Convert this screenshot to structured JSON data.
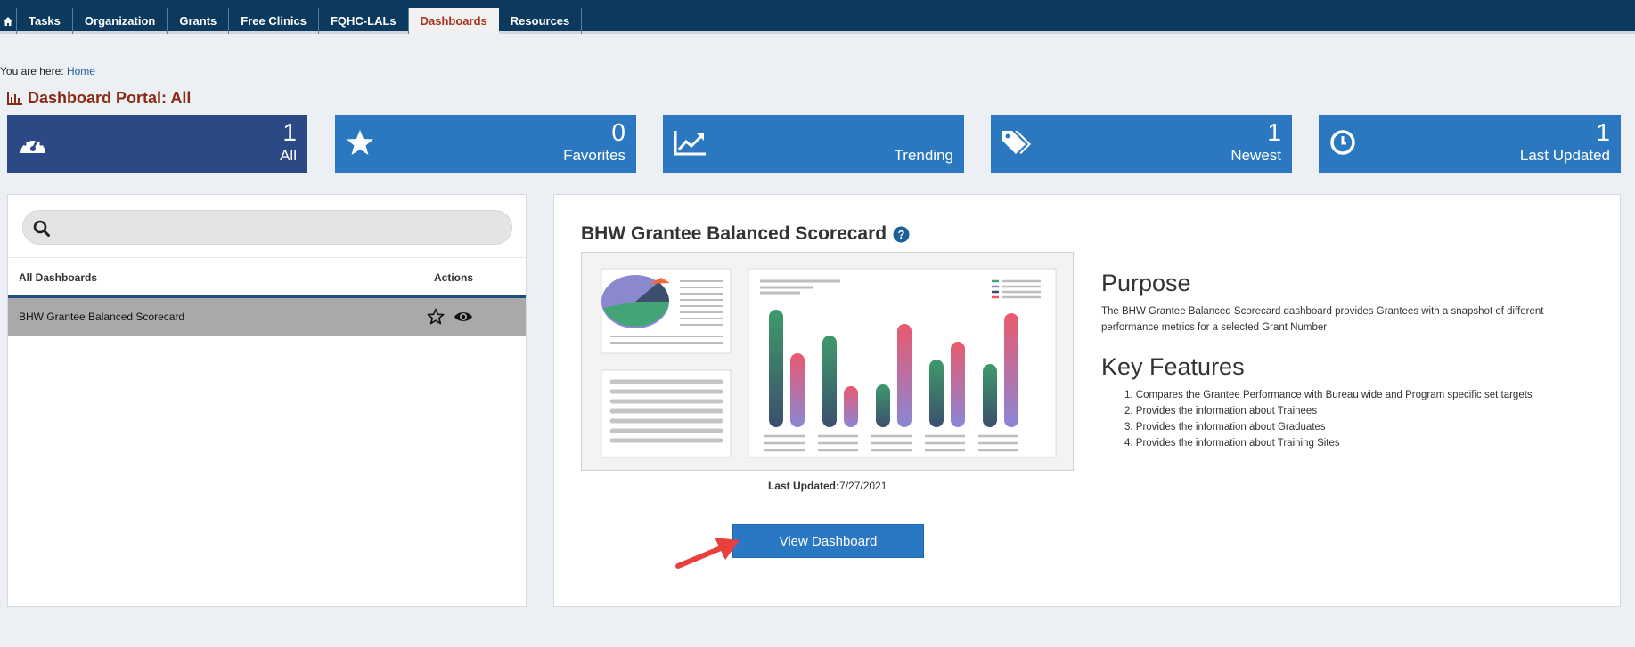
{
  "nav": {
    "items": [
      {
        "label": "Tasks"
      },
      {
        "label": "Organization"
      },
      {
        "label": "Grants"
      },
      {
        "label": "Free Clinics"
      },
      {
        "label": "FQHC-LALs"
      },
      {
        "label": "Dashboards",
        "active": true
      },
      {
        "label": "Resources"
      }
    ]
  },
  "breadcrumb": {
    "prefix": "You are here:",
    "home": "Home"
  },
  "page": {
    "title": "Dashboard Portal: All"
  },
  "tiles": [
    {
      "number": "1",
      "label": "All",
      "color": "#2b4a85",
      "icon": "gauge-icon"
    },
    {
      "number": "0",
      "label": "Favorites",
      "color": "#2b78c0",
      "icon": "star-icon"
    },
    {
      "number": "",
      "label": "Trending",
      "color": "#2b78c0",
      "icon": "trend-icon"
    },
    {
      "number": "1",
      "label": "Newest",
      "color": "#2b78c0",
      "icon": "tags-icon"
    },
    {
      "number": "1",
      "label": "Last Updated",
      "color": "#2b78c0",
      "icon": "clock-icon"
    }
  ],
  "search": {
    "value": "",
    "placeholder": ""
  },
  "table": {
    "col_all": "All Dashboards",
    "col_actions": "Actions",
    "rows": [
      {
        "name": "BHW Grantee Balanced Scorecard"
      }
    ]
  },
  "detail": {
    "title": "BHW Grantee Balanced Scorecard",
    "last_updated_label": "Last Updated:",
    "last_updated_value": "7/27/2021",
    "purpose_heading": "Purpose",
    "purpose_text": "The BHW Grantee Balanced Scorecard dashboard provides Grantees with a snapshot of different performance metrics for a selected Grant Number",
    "features_heading": "Key Features",
    "features": [
      "1. Compares the Grantee Performance with Bureau wide and Program specific set targets",
      "2. Provides the information about Trainees",
      "3. Provides the information about Graduates",
      "4. Provides the information about Training Sites"
    ],
    "view_button": "View Dashboard"
  },
  "colors": {
    "navbar": "#0c3a5e",
    "active_tab_text": "#a3341b",
    "title": "#8b2a14",
    "tile_all": "#2b4a85",
    "tile": "#2b78c0",
    "button": "#2a78c3",
    "arrow": "#e8403d"
  }
}
